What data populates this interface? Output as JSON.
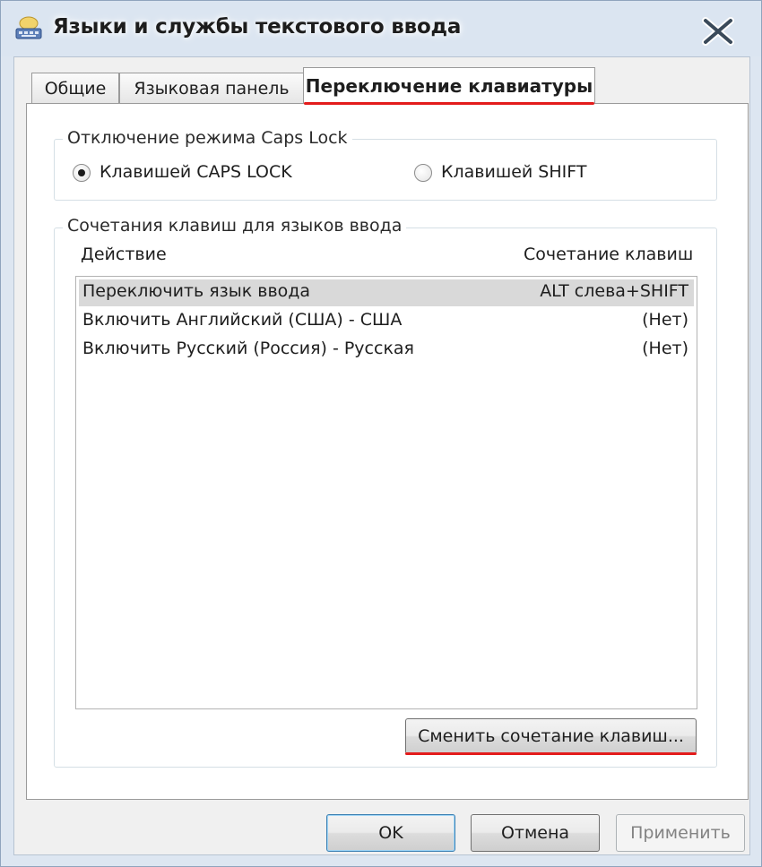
{
  "window": {
    "title": "Языки и службы текстового ввода",
    "icon": "keyboard-icon"
  },
  "tabs": [
    {
      "label": "Общие",
      "active": false
    },
    {
      "label": "Языковая панель",
      "active": false
    },
    {
      "label": "Переключение клавиатуры",
      "active": true
    }
  ],
  "caps_lock": {
    "title": "Отключение режима Caps Lock",
    "options": [
      {
        "label": "Клавишей CAPS LOCK",
        "checked": true
      },
      {
        "label": "Клавишей SHIFT",
        "checked": false
      }
    ]
  },
  "hotkeys": {
    "title": "Сочетания клавиш для языков ввода",
    "columns": {
      "action": "Действие",
      "keys": "Сочетание клавиш"
    },
    "rows": [
      {
        "action": "Переключить язык ввода",
        "keys": "ALT слева+SHIFT",
        "selected": true
      },
      {
        "action": "Включить Английский (США) - США",
        "keys": "(Нет)",
        "selected": false
      },
      {
        "action": "Включить Русский (Россия) - Русская",
        "keys": "(Нет)",
        "selected": false
      }
    ],
    "change_button": "Сменить сочетание клавиш..."
  },
  "buttons": {
    "ok": "OK",
    "cancel": "Отмена",
    "apply": "Применить"
  },
  "colors": {
    "annotation_red": "#e31b1b",
    "selected_row": "#d9d9d9"
  }
}
